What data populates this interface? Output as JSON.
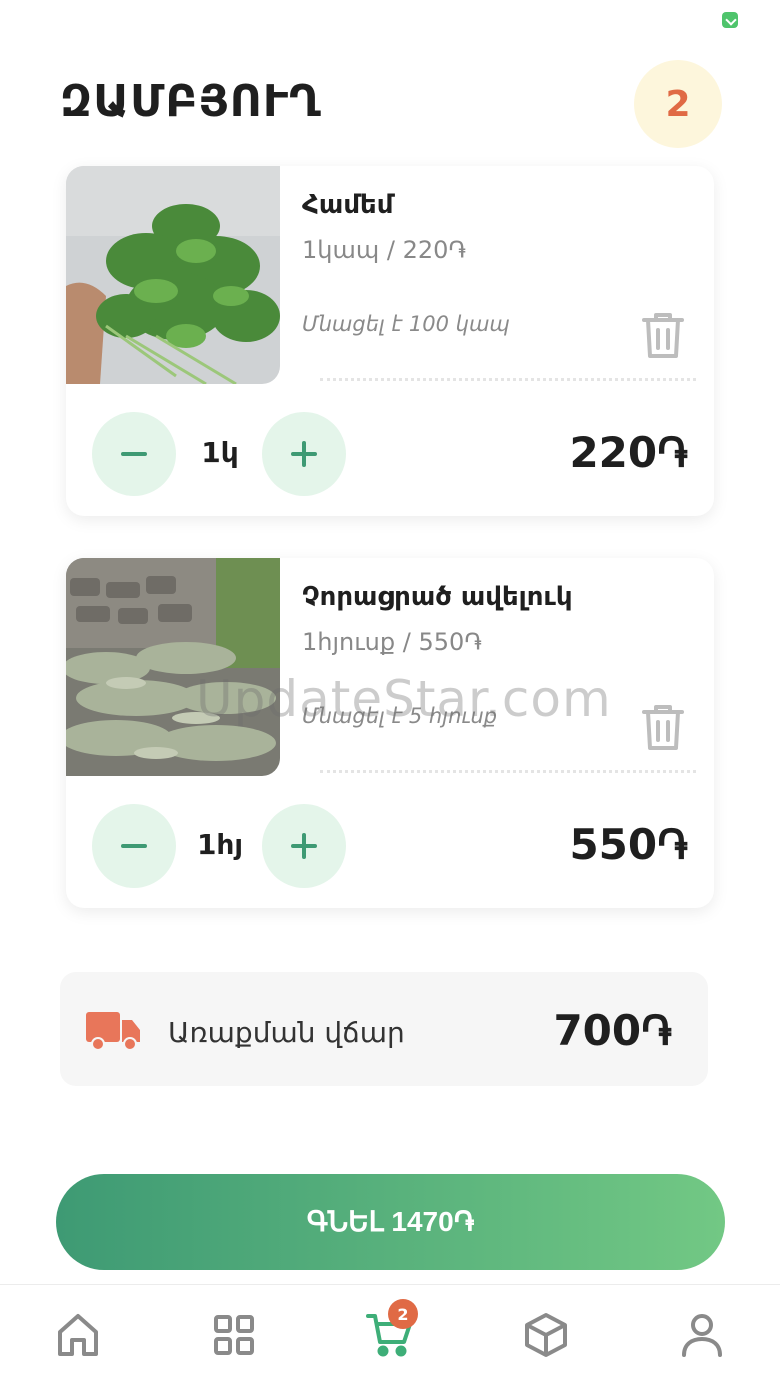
{
  "header": {
    "title": "ԶԱՄԲՅՈՒՂ",
    "cart_count": "2"
  },
  "items": [
    {
      "name": "Համեմ",
      "unit_price": "1կապ / 220֏",
      "stock": "Մնացել է 100 կապ",
      "quantity": "1կ",
      "total": "220֏",
      "image": "parsley-bunch-photo"
    },
    {
      "name": "Չորացրած ավելուկ",
      "unit_price": "1հյուսք / 550֏",
      "stock": "Մնացել է 5 հյուսք",
      "quantity": "1հյ",
      "total": "550֏",
      "image": "dried-sorrel-braids-photo"
    }
  ],
  "delivery": {
    "label": "Առաքման վճար",
    "price": "700֏",
    "icon": "truck-icon"
  },
  "checkout": {
    "label": "ԳՆԵԼ 1470֏"
  },
  "bottom_nav": [
    {
      "name": "home",
      "icon": "home-icon"
    },
    {
      "name": "categories",
      "icon": "grid-icon"
    },
    {
      "name": "cart",
      "icon": "cart-icon",
      "badge": "2",
      "active": true
    },
    {
      "name": "orders",
      "icon": "box-icon"
    },
    {
      "name": "profile",
      "icon": "user-icon"
    }
  ],
  "colors": {
    "accent": "#3e9a74",
    "accent_light": "#72c884",
    "badge": "#e06a45",
    "qty_button_bg": "#e4f5ea"
  },
  "watermark": "UpdateStar.com"
}
